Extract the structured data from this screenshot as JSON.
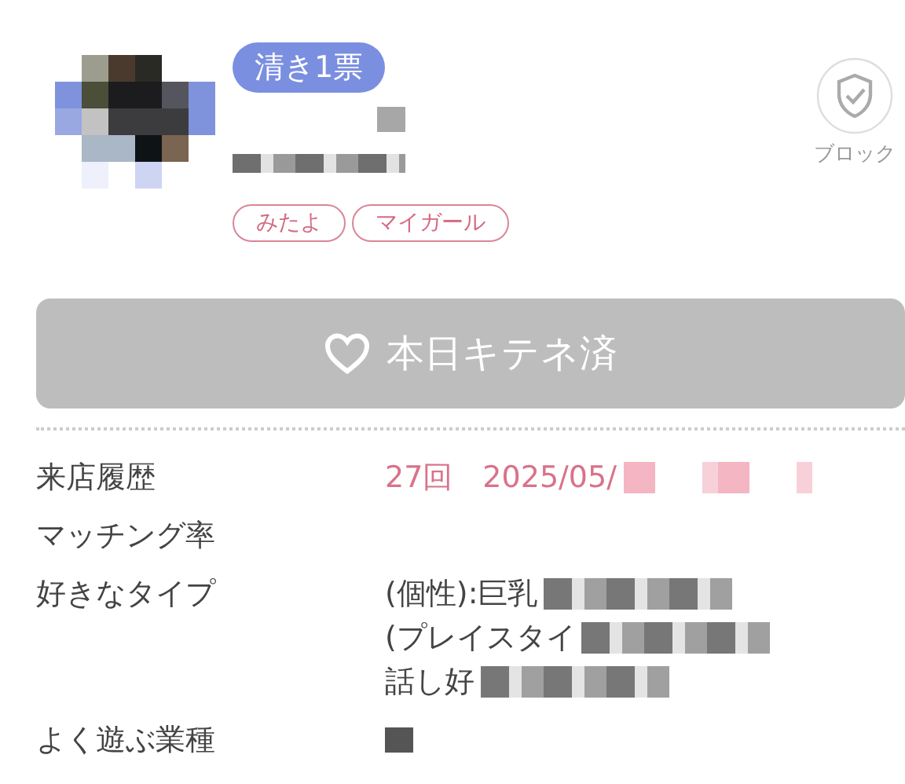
{
  "profile": {
    "avatar": {
      "kind": "picture"
    },
    "badge": "清き1票",
    "tags": [
      "みたよ",
      "マイガール"
    ],
    "block_label": "ブロック"
  },
  "kitene_button": {
    "label": "本日キテネ済"
  },
  "details": [
    {
      "label": "来店履歴",
      "values": [
        "27回　2025/05/"
      ],
      "accent": true
    },
    {
      "label": "マッチング率"
    },
    {
      "label": "好きなタイプ",
      "values": [
        "(個性):巨乳",
        "(プレイスタイ",
        "話し好"
      ]
    },
    {
      "label": "よく遊ぶ業種"
    }
  ]
}
